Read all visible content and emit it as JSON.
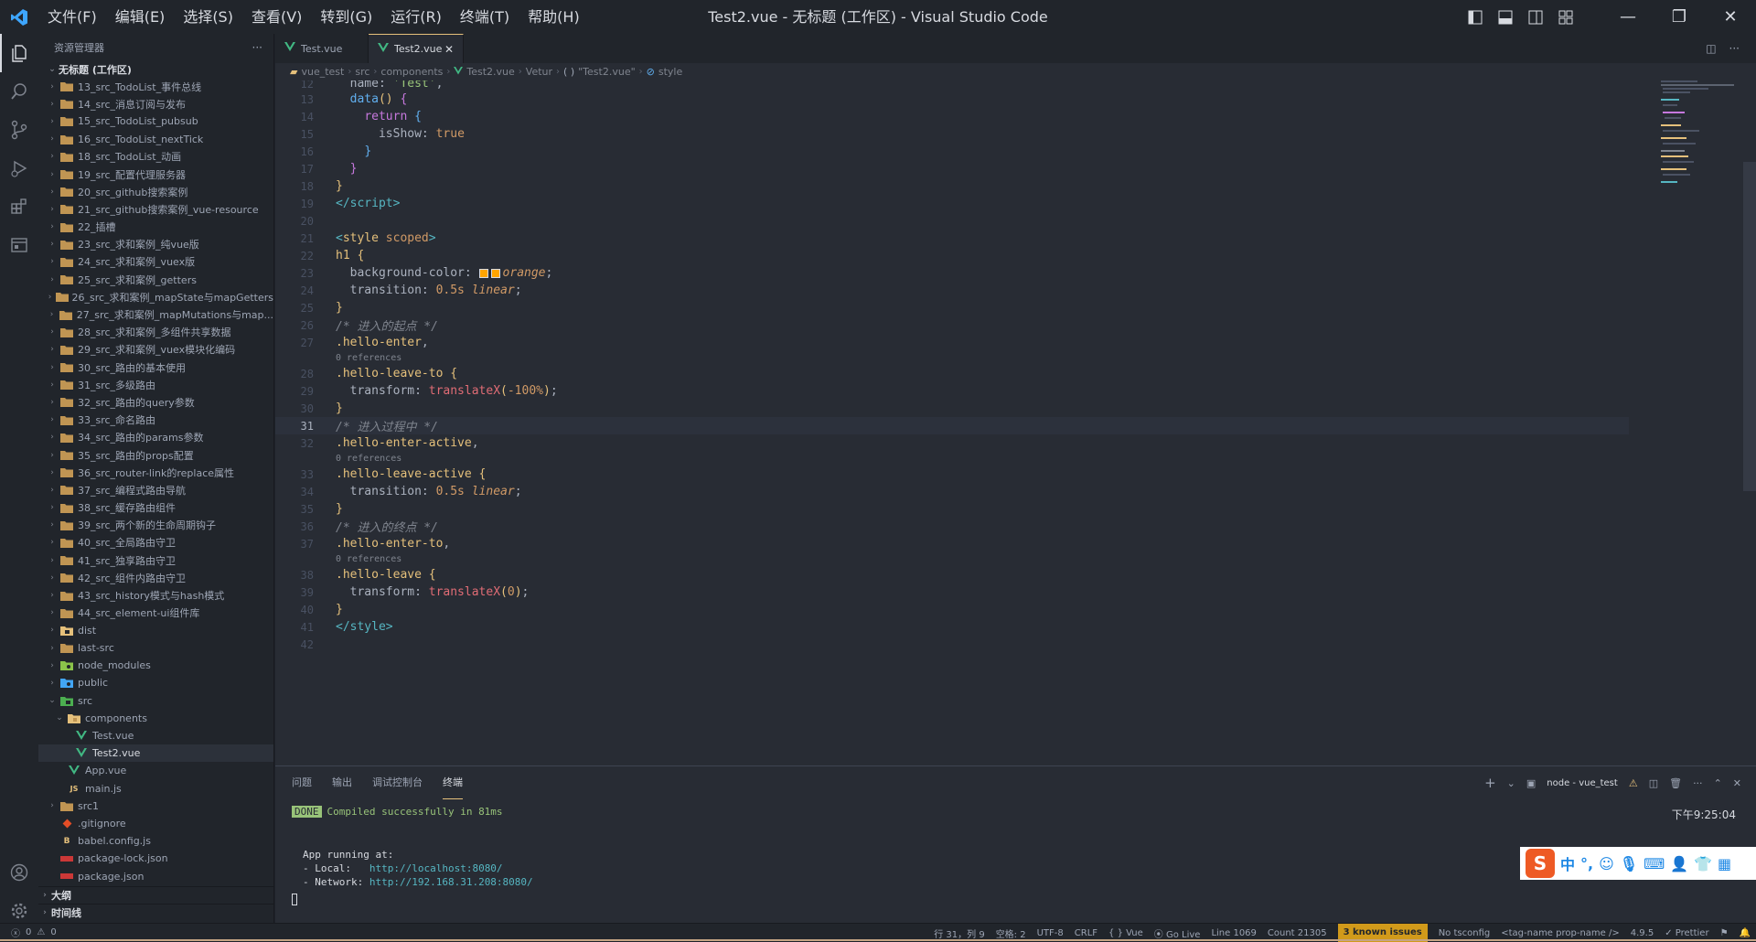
{
  "titlebar": {
    "title": "Test2.vue - 无标题 (工作区) - Visual Studio Code",
    "menu": [
      "文件(F)",
      "编辑(E)",
      "选择(S)",
      "查看(V)",
      "转到(G)",
      "运行(R)",
      "终端(T)",
      "帮助(H)"
    ],
    "layout_icons": [
      "toggle-primary-sidebar-icon",
      "toggle-panel-icon",
      "toggle-secondary-sidebar-icon",
      "customize-layout-icon"
    ],
    "window_controls": {
      "minimize": "—",
      "restore": "❐",
      "close": "✕"
    }
  },
  "sidebar": {
    "title": "资源管理器",
    "more": "···",
    "workspace": "无标题 (工作区)",
    "items": [
      {
        "label": "13_src_TodoList_事件总线",
        "type": "folder",
        "indent": 1,
        "open": false
      },
      {
        "label": "14_src_消息订阅与发布",
        "type": "folder",
        "indent": 1,
        "open": false
      },
      {
        "label": "15_src_TodoList_pubsub",
        "type": "folder",
        "indent": 1,
        "open": false
      },
      {
        "label": "16_src_TodoList_nextTick",
        "type": "folder",
        "indent": 1,
        "open": false
      },
      {
        "label": "18_src_TodoList_动画",
        "type": "folder",
        "indent": 1,
        "open": false
      },
      {
        "label": "19_src_配置代理服务器",
        "type": "folder",
        "indent": 1,
        "open": false
      },
      {
        "label": "20_src_github搜索案例",
        "type": "folder",
        "indent": 1,
        "open": false
      },
      {
        "label": "21_src_github搜索案例_vue-resource",
        "type": "folder",
        "indent": 1,
        "open": false
      },
      {
        "label": "22_插槽",
        "type": "folder",
        "indent": 1,
        "open": false
      },
      {
        "label": "23_src_求和案例_纯vue版",
        "type": "folder",
        "indent": 1,
        "open": false
      },
      {
        "label": "24_src_求和案例_vuex版",
        "type": "folder",
        "indent": 1,
        "open": false
      },
      {
        "label": "25_src_求和案例_getters",
        "type": "folder",
        "indent": 1,
        "open": false
      },
      {
        "label": "26_src_求和案例_mapState与mapGetters",
        "type": "folder",
        "indent": 1,
        "open": false
      },
      {
        "label": "27_src_求和案例_mapMutations与map...",
        "type": "folder",
        "indent": 1,
        "open": false
      },
      {
        "label": "28_src_求和案例_多组件共享数据",
        "type": "folder",
        "indent": 1,
        "open": false
      },
      {
        "label": "29_src_求和案例_vuex模块化编码",
        "type": "folder",
        "indent": 1,
        "open": false
      },
      {
        "label": "30_src_路由的基本使用",
        "type": "folder",
        "indent": 1,
        "open": false
      },
      {
        "label": "31_src_多级路由",
        "type": "folder",
        "indent": 1,
        "open": false
      },
      {
        "label": "32_src_路由的query参数",
        "type": "folder",
        "indent": 1,
        "open": false
      },
      {
        "label": "33_src_命名路由",
        "type": "folder",
        "indent": 1,
        "open": false
      },
      {
        "label": "34_src_路由的params参数",
        "type": "folder",
        "indent": 1,
        "open": false
      },
      {
        "label": "35_src_路由的props配置",
        "type": "folder",
        "indent": 1,
        "open": false
      },
      {
        "label": "36_src_router-link的replace属性",
        "type": "folder",
        "indent": 1,
        "open": false
      },
      {
        "label": "37_src_编程式路由导航",
        "type": "folder",
        "indent": 1,
        "open": false
      },
      {
        "label": "38_src_缓存路由组件",
        "type": "folder",
        "indent": 1,
        "open": false
      },
      {
        "label": "39_src_两个新的生命周期钩子",
        "type": "folder",
        "indent": 1,
        "open": false
      },
      {
        "label": "40_src_全局路由守卫",
        "type": "folder",
        "indent": 1,
        "open": false
      },
      {
        "label": "41_src_独享路由守卫",
        "type": "folder",
        "indent": 1,
        "open": false
      },
      {
        "label": "42_src_组件内路由守卫",
        "type": "folder",
        "indent": 1,
        "open": false
      },
      {
        "label": "43_src_history模式与hash模式",
        "type": "folder",
        "indent": 1,
        "open": false
      },
      {
        "label": "44_src_element-ui组件库",
        "type": "folder",
        "indent": 1,
        "open": false
      },
      {
        "label": "dist",
        "type": "folder-dist",
        "indent": 1,
        "open": false
      },
      {
        "label": "last-src",
        "type": "folder",
        "indent": 1,
        "open": false
      },
      {
        "label": "node_modules",
        "type": "folder-node",
        "indent": 1,
        "open": false
      },
      {
        "label": "public",
        "type": "folder-public",
        "indent": 1,
        "open": false
      },
      {
        "label": "src",
        "type": "folder-src",
        "indent": 1,
        "open": true
      },
      {
        "label": "components",
        "type": "folder-components",
        "indent": 2,
        "open": true
      },
      {
        "label": "Test.vue",
        "type": "vue",
        "indent": 3
      },
      {
        "label": "Test2.vue",
        "type": "vue",
        "indent": 3,
        "active": true
      },
      {
        "label": "App.vue",
        "type": "vue",
        "indent": 2
      },
      {
        "label": "main.js",
        "type": "js",
        "indent": 2
      },
      {
        "label": "src1",
        "type": "folder",
        "indent": 1,
        "open": false
      },
      {
        "label": ".gitignore",
        "type": "git",
        "indent": 1
      },
      {
        "label": "babel.config.js",
        "type": "babel",
        "indent": 1
      },
      {
        "label": "package-lock.json",
        "type": "npm",
        "indent": 1
      },
      {
        "label": "package.json",
        "type": "npm",
        "indent": 1
      }
    ],
    "outline": "大纲",
    "timeline": "时间线"
  },
  "editor": {
    "tabs": [
      {
        "label": "Test.vue",
        "active": false
      },
      {
        "label": "Test2.vue",
        "active": true,
        "close": "✕"
      }
    ],
    "breadcrumb": [
      "vue_test",
      "src",
      "components",
      "Test2.vue",
      "Vetur",
      "\"Test2.vue\"",
      "style"
    ],
    "codelens": "0 references"
  },
  "panel": {
    "tabs": [
      "问题",
      "输出",
      "调试控制台",
      "终端"
    ],
    "active_tab": "终端",
    "terminal_name": "node - vue_test",
    "done": "DONE",
    "compiled": "Compiled successfully in 81ms",
    "time": "下午9:25:04",
    "running": "App running at:",
    "local_label": "- Local:   ",
    "local_url": "http://localhost:8080/",
    "network_label": "- Network: ",
    "network_url": "http://192.168.31.208:8080/",
    "ime": {
      "lang": "中",
      "punct": "°,"
    }
  },
  "statusbar": {
    "errors": "0",
    "warnings": "0",
    "position": "行 31，列 9",
    "spaces": "空格: 2",
    "encoding": "UTF-8",
    "eol": "CRLF",
    "language": "Vue",
    "golive": "Go Live",
    "line": "Line 1069",
    "count": "Count 21305",
    "issues": "3 known issues",
    "tsconfig": "No tsconfig",
    "tag": "<tag-name prop-name />",
    "version": "4.9.5",
    "prettier": "Prettier"
  },
  "colors": {
    "accent": "#e5c07b",
    "background": "#282c34",
    "sidebar": "#21252b",
    "orange_swatch": "#ffa500"
  }
}
